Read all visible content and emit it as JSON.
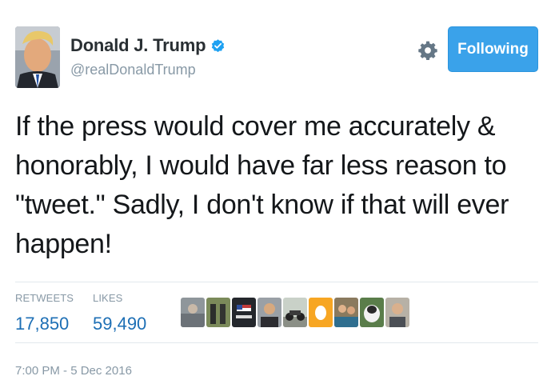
{
  "user": {
    "display_name": "Donald J. Trump",
    "handle": "@realDonaldTrump",
    "verified": true,
    "avatar_icon": "profile-photo"
  },
  "actions": {
    "settings_icon": "gear-icon",
    "follow_label": "Following"
  },
  "tweet": {
    "text": "If the press would cover me accurately & honorably, I would have far less reason to \"tweet.\" Sadly, I don't know if that will ever happen!"
  },
  "stats": {
    "retweets_label": "RETWEETS",
    "retweets_value": "17,850",
    "likes_label": "LIKES",
    "likes_value": "59,490"
  },
  "likers": [
    {
      "name": "liker-avatar-1"
    },
    {
      "name": "liker-avatar-2"
    },
    {
      "name": "liker-avatar-3"
    },
    {
      "name": "liker-avatar-4"
    },
    {
      "name": "liker-avatar-5"
    },
    {
      "name": "liker-avatar-6"
    },
    {
      "name": "liker-avatar-7"
    },
    {
      "name": "liker-avatar-8"
    },
    {
      "name": "liker-avatar-9"
    }
  ],
  "timestamp": "7:00 PM - 5 Dec 2016",
  "colors": {
    "accent": "#3aa2ea",
    "stat_value": "#1d6fb5",
    "muted": "#8899a6",
    "verified": "#1da1f2"
  }
}
